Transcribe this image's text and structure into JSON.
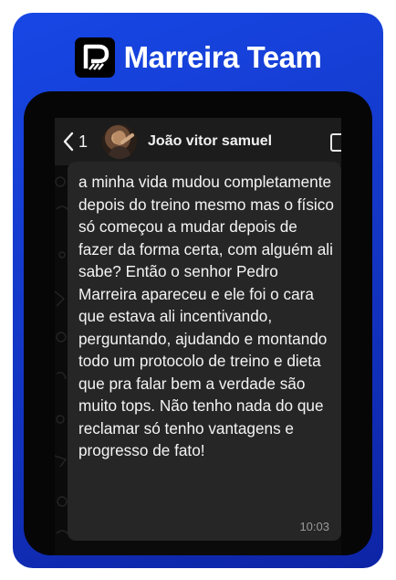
{
  "brand": {
    "name": "Marreira Team",
    "logo_icon": "marreira-p-logo-icon"
  },
  "chat": {
    "back_count": "1",
    "back_icon": "chevron-left-icon",
    "contact_name": "João vitor samuel",
    "message": {
      "text": "a minha vida mudou completamente depois do treino mesmo mas o físico só começou a mudar depois de fazer da forma certa, com alguém ali sabe? Então o senhor Pedro Marreira apareceu e ele foi o cara que estava ali incentivando, perguntando, ajudando e montando todo um protocolo de treino e dieta que pra falar bem a verdade são muito tops. Não tenho nada do que reclamar só tenho vantagens e progresso de fato!",
      "time": "10:03"
    }
  },
  "colors": {
    "card_gradient_start": "#1747e6",
    "card_gradient_end": "#0d24a6",
    "bubble": "#262626",
    "header": "#1c1c1c"
  }
}
